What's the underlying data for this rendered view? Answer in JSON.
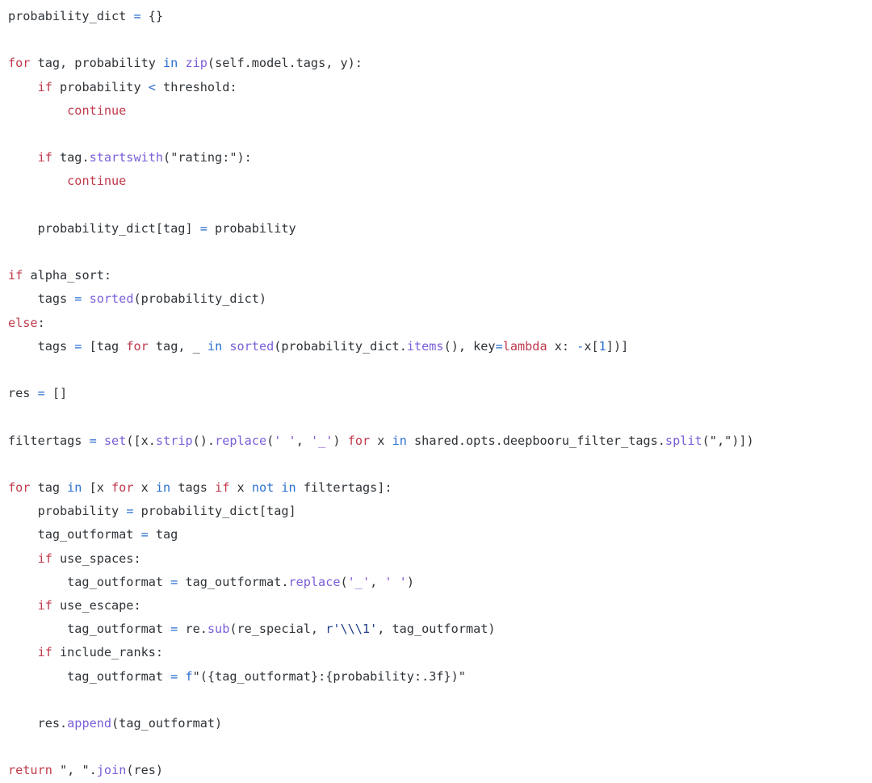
{
  "editor": {
    "language": "python",
    "background_color": "#ffffff",
    "default_text_color": "#2e3338",
    "theme_colors": {
      "keyword": "#c0394b",
      "operator": "#2b6fd0",
      "membership_keyword": "#2b6fd0",
      "builtin": "#7b5ed9",
      "function_call": "#7b5ed9",
      "string": "#2e3338",
      "string_violet": "#8a5cd6",
      "raw_string": "#1f3f87",
      "number": "#2b6fd0",
      "fstring_prefix": "#2b6fd0"
    }
  },
  "code": {
    "lines": [
      {
        "index": 1,
        "text": "probability_dict = {}",
        "tokens": [
          {
            "t": "probability_dict ",
            "c": "plain"
          },
          {
            "t": "=",
            "c": "op"
          },
          {
            "t": " {}",
            "c": "plain"
          }
        ]
      },
      {
        "index": 2,
        "text": "",
        "tokens": []
      },
      {
        "index": 3,
        "text": "for tag, probability in zip(self.model.tags, y):",
        "tokens": [
          {
            "t": "for",
            "c": "kw"
          },
          {
            "t": " tag, probability ",
            "c": "plain"
          },
          {
            "t": "in",
            "c": "in"
          },
          {
            "t": " ",
            "c": "plain"
          },
          {
            "t": "zip",
            "c": "builtin"
          },
          {
            "t": "(self.model.tags, y):",
            "c": "plain"
          }
        ]
      },
      {
        "index": 4,
        "text": "    if probability < threshold:",
        "tokens": [
          {
            "t": "    ",
            "c": "plain"
          },
          {
            "t": "if",
            "c": "kw"
          },
          {
            "t": " probability ",
            "c": "plain"
          },
          {
            "t": "<",
            "c": "op"
          },
          {
            "t": " threshold:",
            "c": "plain"
          }
        ]
      },
      {
        "index": 5,
        "text": "        continue",
        "tokens": [
          {
            "t": "        ",
            "c": "plain"
          },
          {
            "t": "continue",
            "c": "kw"
          }
        ]
      },
      {
        "index": 6,
        "text": "",
        "tokens": []
      },
      {
        "index": 7,
        "text": "    if tag.startswith(\"rating:\"):",
        "tokens": [
          {
            "t": "    ",
            "c": "plain"
          },
          {
            "t": "if",
            "c": "kw"
          },
          {
            "t": " tag.",
            "c": "plain"
          },
          {
            "t": "startswith",
            "c": "fn"
          },
          {
            "t": "(",
            "c": "plain"
          },
          {
            "t": "\"rating:\"",
            "c": "str"
          },
          {
            "t": "):",
            "c": "plain"
          }
        ]
      },
      {
        "index": 8,
        "text": "        continue",
        "tokens": [
          {
            "t": "        ",
            "c": "plain"
          },
          {
            "t": "continue",
            "c": "kw"
          }
        ]
      },
      {
        "index": 9,
        "text": "",
        "tokens": []
      },
      {
        "index": 10,
        "text": "    probability_dict[tag] = probability",
        "tokens": [
          {
            "t": "    probability_dict[tag] ",
            "c": "plain"
          },
          {
            "t": "=",
            "c": "op"
          },
          {
            "t": " probability",
            "c": "plain"
          }
        ]
      },
      {
        "index": 11,
        "text": "",
        "tokens": []
      },
      {
        "index": 12,
        "text": "if alpha_sort:",
        "tokens": [
          {
            "t": "if",
            "c": "kw"
          },
          {
            "t": " alpha_sort:",
            "c": "plain"
          }
        ]
      },
      {
        "index": 13,
        "text": "    tags = sorted(probability_dict)",
        "tokens": [
          {
            "t": "    tags ",
            "c": "plain"
          },
          {
            "t": "=",
            "c": "op"
          },
          {
            "t": " ",
            "c": "plain"
          },
          {
            "t": "sorted",
            "c": "builtin"
          },
          {
            "t": "(probability_dict)",
            "c": "plain"
          }
        ]
      },
      {
        "index": 14,
        "text": "else:",
        "tokens": [
          {
            "t": "else",
            "c": "kw"
          },
          {
            "t": ":",
            "c": "plain"
          }
        ]
      },
      {
        "index": 15,
        "text": "    tags = [tag for tag, _ in sorted(probability_dict.items(), key=lambda x: -x[1])]",
        "tokens": [
          {
            "t": "    tags ",
            "c": "plain"
          },
          {
            "t": "=",
            "c": "op"
          },
          {
            "t": " [tag ",
            "c": "plain"
          },
          {
            "t": "for",
            "c": "kw"
          },
          {
            "t": " tag, _ ",
            "c": "plain"
          },
          {
            "t": "in",
            "c": "in"
          },
          {
            "t": " ",
            "c": "plain"
          },
          {
            "t": "sorted",
            "c": "builtin"
          },
          {
            "t": "(probability_dict.",
            "c": "plain"
          },
          {
            "t": "items",
            "c": "fn"
          },
          {
            "t": "(), key",
            "c": "plain"
          },
          {
            "t": "=",
            "c": "op"
          },
          {
            "t": "lambda",
            "c": "kw"
          },
          {
            "t": " x: ",
            "c": "plain"
          },
          {
            "t": "-",
            "c": "op"
          },
          {
            "t": "x[",
            "c": "plain"
          },
          {
            "t": "1",
            "c": "num"
          },
          {
            "t": "])]",
            "c": "plain"
          }
        ]
      },
      {
        "index": 16,
        "text": "",
        "tokens": []
      },
      {
        "index": 17,
        "text": "res = []",
        "tokens": [
          {
            "t": "res ",
            "c": "plain"
          },
          {
            "t": "=",
            "c": "op"
          },
          {
            "t": " []",
            "c": "plain"
          }
        ]
      },
      {
        "index": 18,
        "text": "",
        "tokens": []
      },
      {
        "index": 19,
        "text": "filtertags = set([x.strip().replace(' ', '_') for x in shared.opts.deepbooru_filter_tags.split(\",\")])",
        "tokens": [
          {
            "t": "filtertags ",
            "c": "plain"
          },
          {
            "t": "=",
            "c": "op"
          },
          {
            "t": " ",
            "c": "plain"
          },
          {
            "t": "set",
            "c": "builtin"
          },
          {
            "t": "([x.",
            "c": "plain"
          },
          {
            "t": "strip",
            "c": "fn"
          },
          {
            "t": "().",
            "c": "plain"
          },
          {
            "t": "replace",
            "c": "fn"
          },
          {
            "t": "(",
            "c": "plain"
          },
          {
            "t": "' '",
            "c": "strv"
          },
          {
            "t": ", ",
            "c": "plain"
          },
          {
            "t": "'_'",
            "c": "strv"
          },
          {
            "t": ") ",
            "c": "plain"
          },
          {
            "t": "for",
            "c": "kw"
          },
          {
            "t": " x ",
            "c": "plain"
          },
          {
            "t": "in",
            "c": "in"
          },
          {
            "t": " shared.opts.deepbooru_filter_tags.",
            "c": "plain"
          },
          {
            "t": "split",
            "c": "fn"
          },
          {
            "t": "(",
            "c": "plain"
          },
          {
            "t": "\",\"",
            "c": "str"
          },
          {
            "t": ")])",
            "c": "plain"
          }
        ]
      },
      {
        "index": 20,
        "text": "",
        "tokens": []
      },
      {
        "index": 21,
        "text": "for tag in [x for x in tags if x not in filtertags]:",
        "tokens": [
          {
            "t": "for",
            "c": "kw"
          },
          {
            "t": " tag ",
            "c": "plain"
          },
          {
            "t": "in",
            "c": "in"
          },
          {
            "t": " [x ",
            "c": "plain"
          },
          {
            "t": "for",
            "c": "kw"
          },
          {
            "t": " x ",
            "c": "plain"
          },
          {
            "t": "in",
            "c": "in"
          },
          {
            "t": " tags ",
            "c": "plain"
          },
          {
            "t": "if",
            "c": "kw"
          },
          {
            "t": " x ",
            "c": "plain"
          },
          {
            "t": "not",
            "c": "in"
          },
          {
            "t": " ",
            "c": "plain"
          },
          {
            "t": "in",
            "c": "in"
          },
          {
            "t": " filtertags]:",
            "c": "plain"
          }
        ]
      },
      {
        "index": 22,
        "text": "    probability = probability_dict[tag]",
        "tokens": [
          {
            "t": "    probability ",
            "c": "plain"
          },
          {
            "t": "=",
            "c": "op"
          },
          {
            "t": " probability_dict[tag]",
            "c": "plain"
          }
        ]
      },
      {
        "index": 23,
        "text": "    tag_outformat = tag",
        "tokens": [
          {
            "t": "    tag_outformat ",
            "c": "plain"
          },
          {
            "t": "=",
            "c": "op"
          },
          {
            "t": " tag",
            "c": "plain"
          }
        ]
      },
      {
        "index": 24,
        "text": "    if use_spaces:",
        "tokens": [
          {
            "t": "    ",
            "c": "plain"
          },
          {
            "t": "if",
            "c": "kw"
          },
          {
            "t": " use_spaces:",
            "c": "plain"
          }
        ]
      },
      {
        "index": 25,
        "text": "        tag_outformat = tag_outformat.replace('_', ' ')",
        "tokens": [
          {
            "t": "        tag_outformat ",
            "c": "plain"
          },
          {
            "t": "=",
            "c": "op"
          },
          {
            "t": " tag_outformat.",
            "c": "plain"
          },
          {
            "t": "replace",
            "c": "fn"
          },
          {
            "t": "(",
            "c": "plain"
          },
          {
            "t": "'_'",
            "c": "strv"
          },
          {
            "t": ", ",
            "c": "plain"
          },
          {
            "t": "' '",
            "c": "strv"
          },
          {
            "t": ")",
            "c": "plain"
          }
        ]
      },
      {
        "index": 26,
        "text": "    if use_escape:",
        "tokens": [
          {
            "t": "    ",
            "c": "plain"
          },
          {
            "t": "if",
            "c": "kw"
          },
          {
            "t": " use_escape:",
            "c": "plain"
          }
        ]
      },
      {
        "index": 27,
        "text": "        tag_outformat = re.sub(re_special, r'\\\\\\1', tag_outformat)",
        "tokens": [
          {
            "t": "        tag_outformat ",
            "c": "plain"
          },
          {
            "t": "=",
            "c": "op"
          },
          {
            "t": " re.",
            "c": "plain"
          },
          {
            "t": "sub",
            "c": "fn"
          },
          {
            "t": "(re_special, ",
            "c": "plain"
          },
          {
            "t": "r'\\\\\\1'",
            "c": "rawstr"
          },
          {
            "t": ", tag_outformat)",
            "c": "plain"
          }
        ]
      },
      {
        "index": 28,
        "text": "    if include_ranks:",
        "tokens": [
          {
            "t": "    ",
            "c": "plain"
          },
          {
            "t": "if",
            "c": "kw"
          },
          {
            "t": " include_ranks:",
            "c": "plain"
          }
        ]
      },
      {
        "index": 29,
        "text": "        tag_outformat = f\"({tag_outformat}:{probability:.3f})\"",
        "tokens": [
          {
            "t": "        tag_outformat ",
            "c": "plain"
          },
          {
            "t": "=",
            "c": "op"
          },
          {
            "t": " ",
            "c": "plain"
          },
          {
            "t": "f",
            "c": "fprefix"
          },
          {
            "t": "\"({tag_outformat}:{probability:.3f})\"",
            "c": "str"
          }
        ]
      },
      {
        "index": 30,
        "text": "",
        "tokens": []
      },
      {
        "index": 31,
        "text": "    res.append(tag_outformat)",
        "tokens": [
          {
            "t": "    res.",
            "c": "plain"
          },
          {
            "t": "append",
            "c": "fn"
          },
          {
            "t": "(tag_outformat)",
            "c": "plain"
          }
        ]
      },
      {
        "index": 32,
        "text": "",
        "tokens": []
      },
      {
        "index": 33,
        "text": "return \", \".join(res)",
        "tokens": [
          {
            "t": "return",
            "c": "kw"
          },
          {
            "t": " ",
            "c": "plain"
          },
          {
            "t": "\", \"",
            "c": "str"
          },
          {
            "t": ".",
            "c": "plain"
          },
          {
            "t": "join",
            "c": "fn"
          },
          {
            "t": "(res)",
            "c": "plain"
          }
        ]
      }
    ]
  }
}
